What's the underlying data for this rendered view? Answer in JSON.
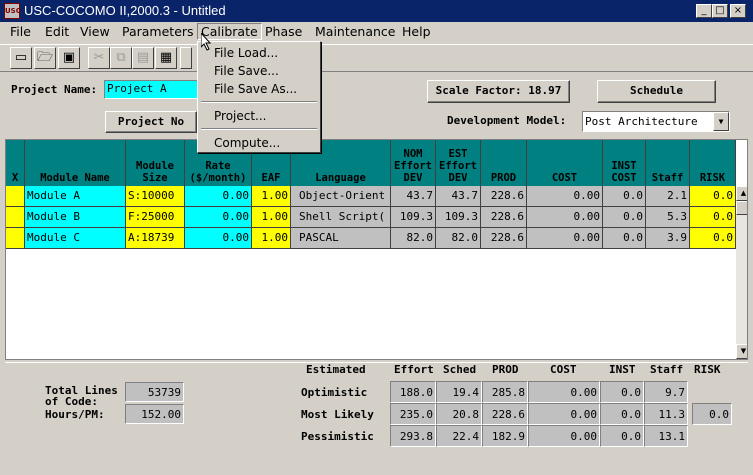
{
  "window": {
    "title": "USC-COCOMO II,2000.3 - Untitled",
    "icon_text": "USC"
  },
  "menu": [
    {
      "label": "File"
    },
    {
      "label": "Edit"
    },
    {
      "label": "View"
    },
    {
      "label": "Parameters"
    },
    {
      "label": "Calibrate"
    },
    {
      "label": "Phase"
    },
    {
      "label": "Maintenance"
    },
    {
      "label": "Help"
    }
  ],
  "calibrate_menu": [
    "File Load...",
    "File Save...",
    "File Save As...",
    "Project...",
    "Compute..."
  ],
  "toolbar_icons": [
    "new-icon",
    "open-icon",
    "save-icon",
    "cut-icon",
    "copy-icon",
    "paste-icon",
    "add-module-icon"
  ],
  "project": {
    "name_label": "Project Name:",
    "name_value": "Project A",
    "notes_button": "Project No",
    "scale_factor_button": "Scale Factor: 18.97",
    "schedule_button": "Schedule",
    "dev_model_label": "Development Model:",
    "dev_model_value": "Post Architecture"
  },
  "grid": {
    "columns": [
      "X",
      "Module Name",
      "Module Size",
      "Rate ($/month)",
      "EAF",
      "Language",
      "NOM Effort DEV",
      "EST Effort DEV",
      "PROD",
      "COST",
      "INST COST",
      "Staff",
      "RISK"
    ],
    "rows": [
      {
        "x": "",
        "name": "Module A",
        "size": "S:10000",
        "rate": "0.00",
        "eaf": "1.00",
        "language": "Object-Orient",
        "nom": "43.7",
        "est": "43.7",
        "prod": "228.6",
        "cost": "0.00",
        "inst": "0.0",
        "staff": "2.1",
        "risk": "0.0"
      },
      {
        "x": "",
        "name": "Module B",
        "size": "F:25000",
        "rate": "0.00",
        "eaf": "1.00",
        "language": "Shell Script(",
        "nom": "109.3",
        "est": "109.3",
        "prod": "228.6",
        "cost": "0.00",
        "inst": "0.0",
        "staff": "5.3",
        "risk": "0.0"
      },
      {
        "x": "",
        "name": "Module C",
        "size": "A:18739",
        "rate": "0.00",
        "eaf": "1.00",
        "language": "PASCAL",
        "nom": "82.0",
        "est": "82.0",
        "prod": "228.6",
        "cost": "0.00",
        "inst": "0.0",
        "staff": "3.9",
        "risk": "0.0"
      }
    ]
  },
  "totals": {
    "loc_label_1": "Total Lines",
    "loc_label_2": "of Code:",
    "loc_value": "53739",
    "hours_label": "Hours/PM:",
    "hours_value": "152.00"
  },
  "estimates": {
    "headers": [
      "Estimated",
      "Effort",
      "Sched",
      "PROD",
      "COST",
      "INST",
      "Staff",
      "RISK"
    ],
    "rows": [
      {
        "label": "Optimistic",
        "effort": "188.0",
        "sched": "19.4",
        "prod": "285.8",
        "cost": "0.00",
        "inst": "0.0",
        "staff": "9.7",
        "risk": ""
      },
      {
        "label": "Most Likely",
        "effort": "235.0",
        "sched": "20.8",
        "prod": "228.6",
        "cost": "0.00",
        "inst": "0.0",
        "staff": "11.3",
        "risk": "0.0"
      },
      {
        "label": "Pessimistic",
        "effort": "293.8",
        "sched": "22.4",
        "prod": "182.9",
        "cost": "0.00",
        "inst": "0.0",
        "staff": "13.1",
        "risk": ""
      }
    ]
  }
}
